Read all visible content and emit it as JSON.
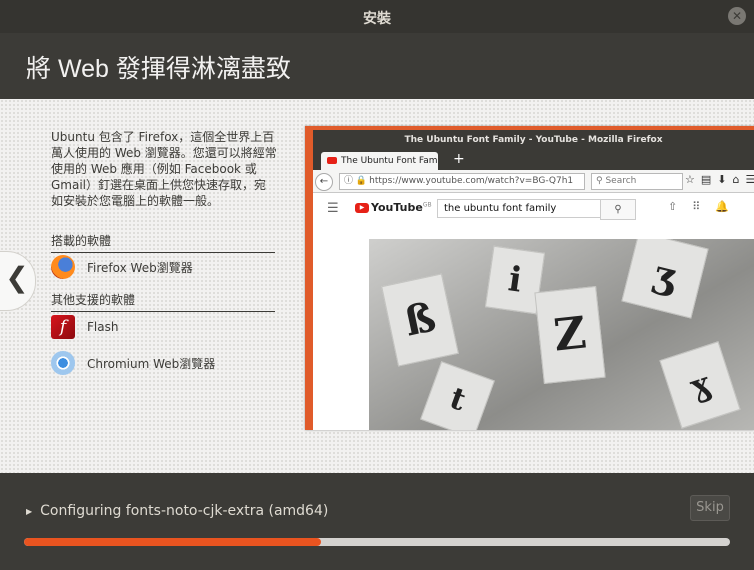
{
  "window": {
    "title": "安裝"
  },
  "header": {
    "heading": "將 Web 發揮得淋漓盡致"
  },
  "slide": {
    "description": "Ubuntu 包含了 Firefox，這個全世界上百萬人使用的 Web 瀏覽器。您還可以將經常使用的 Web 應用（例如 Facebook 或 Gmail）釘選在桌面上供您快速存取，宛如安裝於您電腦上的軟體一般。",
    "included_title": "搭載的軟體",
    "included": [
      {
        "label": "Firefox Web瀏覽器",
        "icon": "firefox-icon"
      }
    ],
    "supported_title": "其他支援的軟體",
    "supported": [
      {
        "label": "Flash",
        "icon": "flash-icon",
        "glyph": "f"
      },
      {
        "label": "Chromium Web瀏覽器",
        "icon": "chromium-icon"
      }
    ],
    "nav": {
      "prev": "❮",
      "next": "❯"
    }
  },
  "screenshot": {
    "window_title": "The Ubuntu Font Family - YouTube - Mozilla Firefox",
    "tab_title": "The Ubuntu Font Family",
    "new_tab": "+",
    "url": "https://www.youtube.com/watch?v=BG-Q7h1",
    "search_placeholder": "Search",
    "youtube_logo": "YouTube",
    "youtube_region": "GB",
    "youtube_query": "the ubuntu font family"
  },
  "footer": {
    "status": "Configuring fonts-noto-cjk-extra (amd64)",
    "skip_label": "Skip",
    "progress": 0.42
  },
  "colors": {
    "accent": "#e95420",
    "background": "#3c3b37",
    "slide": "#f2f1f0"
  }
}
